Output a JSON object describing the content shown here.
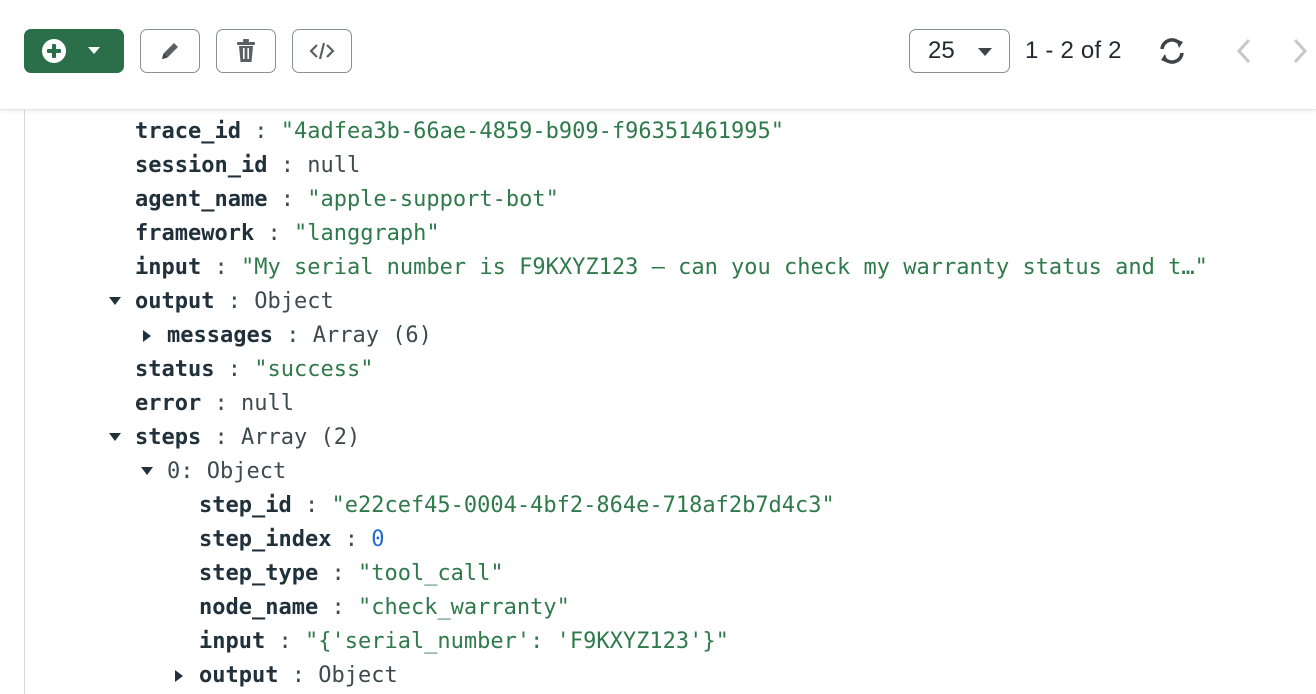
{
  "toolbar": {
    "add_icon": "plus-circle-icon",
    "add_caret_icon": "caret-down-icon",
    "edit_icon": "pencil-icon",
    "delete_icon": "trash-icon",
    "code_icon": "code-icon",
    "accent_color": "#2a6f4a"
  },
  "pagination": {
    "page_size": "25",
    "range": "1 - 2 of 2",
    "refresh_icon": "refresh-icon",
    "prev_icon": "chevron-left-icon",
    "next_icon": "chevron-right-icon"
  },
  "doc": {
    "trace_id": {
      "key": "trace_id",
      "value": "\"4adfea3b-66ae-4859-b909-f96351461995\""
    },
    "session_id": {
      "key": "session_id",
      "value": "null"
    },
    "agent_name": {
      "key": "agent_name",
      "value": "\"apple-support-bot\""
    },
    "framework": {
      "key": "framework",
      "value": "\"langgraph\""
    },
    "input": {
      "key": "input",
      "value": "\"My serial number is F9KXYZ123 — can you check my warranty status and t…\""
    },
    "output": {
      "key": "output",
      "value": "Object"
    },
    "messages": {
      "key": "messages",
      "value": "Array (6)"
    },
    "status": {
      "key": "status",
      "value": "\"success\""
    },
    "error": {
      "key": "error",
      "value": "null"
    },
    "steps": {
      "key": "steps",
      "value": "Array (2)"
    },
    "step0": {
      "key": "0",
      "value": "Object"
    },
    "step_id": {
      "key": "step_id",
      "value": "\"e22cef45-0004-4bf2-864e-718af2b7d4c3\""
    },
    "step_index": {
      "key": "step_index",
      "value": "0"
    },
    "step_type": {
      "key": "step_type",
      "value": "\"tool_call\""
    },
    "node_name": {
      "key": "node_name",
      "value": "\"check_warranty\""
    },
    "step_input": {
      "key": "input",
      "value": "\"{'serial_number': 'F9KXYZ123'}\""
    },
    "step_output": {
      "key": "output",
      "value": "Object"
    }
  },
  "colors": {
    "string": "#2f7a4a",
    "number": "#1f6bd6",
    "key": "#21313c"
  }
}
